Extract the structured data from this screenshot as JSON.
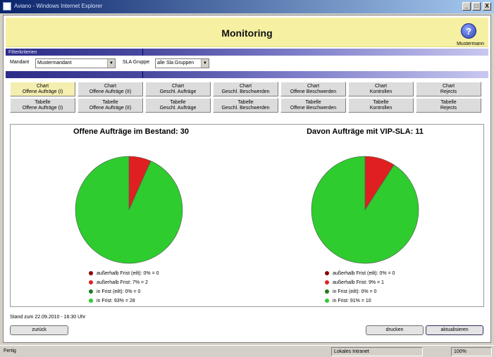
{
  "window": {
    "title": "Aviano - Windows Internet Explorer",
    "minimize": "_",
    "maximize": "□",
    "close": "X"
  },
  "header": {
    "title": "Monitoring",
    "help_glyph": "?",
    "user": "Mustermann"
  },
  "bar_top": {
    "label": "Filterkriterien"
  },
  "filters": {
    "mandant_label": "Mandant",
    "mandant_value": "Mustermandant",
    "sla_label": "SLA Gruppe",
    "sla_value": "alle Sla Gruppen"
  },
  "tabs": {
    "chart": [
      {
        "line1": "Chart",
        "line2": "Offene Aufträge (I)",
        "active": true
      },
      {
        "line1": "Chart",
        "line2": "Offene Aufträge (II)",
        "active": false
      },
      {
        "line1": "Chart",
        "line2": "Geschl. Aufträge",
        "active": false
      },
      {
        "line1": "Chart",
        "line2": "Geschl. Beschwerden",
        "active": false
      },
      {
        "line1": "Chart",
        "line2": "Offene Beschwerden",
        "active": false
      },
      {
        "line1": "Chart",
        "line2": "Kontrollen",
        "active": false
      },
      {
        "line1": "Chart",
        "line2": "Rejects",
        "active": false
      }
    ],
    "table": [
      {
        "line1": "Tabelle",
        "line2": "Offene Aufträge (I)"
      },
      {
        "line1": "Tabelle",
        "line2": "Offene Aufträge (II)"
      },
      {
        "line1": "Tabelle",
        "line2": "Geschl. Aufträge"
      },
      {
        "line1": "Tabelle",
        "line2": "Geschl. Beschwerden"
      },
      {
        "line1": "Tabelle",
        "line2": "Offene Beschwerden"
      },
      {
        "line1": "Tabelle",
        "line2": "Kontrollen"
      },
      {
        "line1": "Tabelle",
        "line2": "Rejects"
      }
    ]
  },
  "chart_data": [
    {
      "type": "pie",
      "title": "Offene Aufträge im Bestand: 30",
      "categories": [
        "außerhalb Frist (eilt)",
        "außerhalb Frist",
        "in Frist (eilt)",
        "in Frist"
      ],
      "values": [
        0,
        2,
        0,
        28
      ],
      "colors": [
        "#8b0000",
        "#e02020",
        "#1e7a1e",
        "#2ecc2e"
      ],
      "legend": [
        "außerhalb Frist (eilt): 0% = 0",
        "außerhalb Frist: 7% = 2",
        "in Frist (eilt): 0% = 0",
        "in Frist: 93% = 28"
      ]
    },
    {
      "type": "pie",
      "title": "Davon Aufträge mit VIP-SLA: 11",
      "categories": [
        "außerhalb Frist (eilt)",
        "außerhalb Frist",
        "in Frist (eilt)",
        "in Frist"
      ],
      "values": [
        0,
        1,
        0,
        10
      ],
      "colors": [
        "#8b0000",
        "#e02020",
        "#1e7a1e",
        "#2ecc2e"
      ],
      "legend": [
        "außerhalb Frist (eilt): 0% = 0",
        "außerhalb Frist: 9% = 1",
        "in Frist (eilt): 0% = 0",
        "in Frist: 91% = 10"
      ]
    }
  ],
  "footer": {
    "stand": "Stand zum 22.09.2010 - 16:30 Uhr",
    "back_label": "zurück",
    "print_label": "drucken",
    "refresh_label": "aktualisieren"
  },
  "statusbar": {
    "left": "Fertig",
    "zone": "Lokales Intranet",
    "zoom": "100%"
  }
}
